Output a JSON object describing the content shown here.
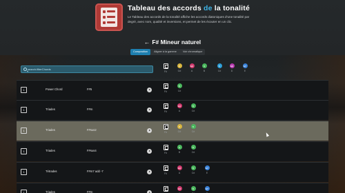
{
  "header": {
    "title_part1": "Tableau des accords ",
    "title_accent": "de",
    "title_part2": " la tonalité",
    "description": "Le Tableau des accords de la tonalité affiche les accords diatoniques d'une tonalité par degré, avec nom, qualité et inversions, et permet de les écouter en un clic.",
    "icon": "chord-table-app-icon"
  },
  "key": {
    "back_icon": "arrow-left-icon",
    "arrow": "←",
    "title": "F# Mineur naturel"
  },
  "tabs": [
    {
      "label": "Composition",
      "active": true
    },
    {
      "label": "Aligner à la gamme",
      "active": false
    },
    {
      "label": "Voir chromatique",
      "active": false
    }
  ],
  "search": {
    "placeholder": "search.filterChords",
    "value": ""
  },
  "notes_header": [
    {
      "label": "F#",
      "symbol": "",
      "color": "",
      "kind": "key"
    },
    {
      "label": "G#",
      "symbol": "2",
      "color": "#d8b640"
    },
    {
      "label": "A",
      "symbol": "b3",
      "color": "#d23a6e"
    },
    {
      "label": "B",
      "symbol": "4",
      "color": "#4bb85e"
    },
    {
      "label": "C#",
      "symbol": "5",
      "color": "#2e9fd8"
    },
    {
      "label": "D",
      "symbol": "b6",
      "color": "#b83ab0"
    },
    {
      "label": "E",
      "symbol": "b7",
      "color": "#3a82d8"
    }
  ],
  "rows": [
    {
      "degree": "1",
      "type": "Power Chord",
      "name": "F#5",
      "highlight": false,
      "notes": [
        {
          "label": "F#",
          "kind": "key"
        },
        {
          "label": "C#",
          "symbol": "5",
          "color": "#4bb85e"
        }
      ]
    },
    {
      "degree": "1",
      "type": "Triades",
      "name": "F#m",
      "highlight": false,
      "notes": [
        {
          "label": "F#",
          "kind": "key"
        },
        {
          "label": "A",
          "symbol": "b3",
          "color": "#d23a6e"
        },
        {
          "label": "C#",
          "symbol": "5",
          "color": "#4bb85e"
        }
      ]
    },
    {
      "degree": "1",
      "type": "Triades",
      "name": "F#sus2",
      "highlight": true,
      "notes": [
        {
          "label": "F#",
          "kind": "key"
        },
        {
          "label": "G#",
          "symbol": "2",
          "color": "#d8b640"
        },
        {
          "label": "C#",
          "symbol": "5",
          "color": "#4bb85e"
        }
      ]
    },
    {
      "degree": "1",
      "type": "Triades",
      "name": "F#sus4",
      "highlight": false,
      "notes": [
        {
          "label": "F#",
          "kind": "key"
        },
        {
          "label": "B",
          "symbol": "4",
          "color": "#4bb85e"
        },
        {
          "label": "C#",
          "symbol": "5",
          "color": "#4bb85e"
        }
      ]
    },
    {
      "degree": "1",
      "type": "Tétrades",
      "name": "F#m7 add -7",
      "highlight": false,
      "notes": [
        {
          "label": "F#",
          "kind": "key"
        },
        {
          "label": "A",
          "symbol": "b3",
          "color": "#d23a6e"
        },
        {
          "label": "C#",
          "symbol": "5",
          "color": "#4bb85e"
        },
        {
          "label": "E",
          "symbol": "b7",
          "color": "#3a82d8"
        }
      ]
    },
    {
      "degree": "1",
      "type": "Triades",
      "name": "F#m",
      "highlight": false,
      "notes": [
        {
          "label": "F#",
          "kind": "key"
        },
        {
          "label": "A",
          "symbol": "b3",
          "color": "#d23a6e"
        },
        {
          "label": "C#",
          "symbol": "5",
          "color": "#4bb85e"
        },
        {
          "label": "E",
          "symbol": "b7",
          "color": "#3a82d8"
        }
      ]
    }
  ]
}
